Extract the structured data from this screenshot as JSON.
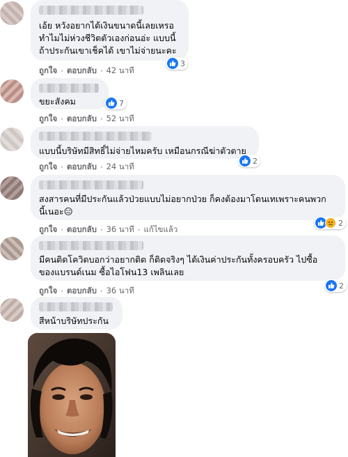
{
  "labels": {
    "like": "ถูกใจ",
    "reply": "ตอบกลับ",
    "edited": "แก้ไขแล้ว",
    "separator": "·"
  },
  "comments": [
    {
      "text": "เอ้ย หวังอยากได้เงินขนาดนี้เลยเหรอ\nทำไมไม่ห่วงชีวิตตัวเองก่อนอ่ะ แบบนี้\nถ้าประกันเขาเช็คได้ เขาไม่จ่ายนะคะ",
      "time": "42 นาที",
      "reaction_count": "3"
    },
    {
      "text": "ขยะสังคม",
      "time": "52 นาที",
      "reaction_count": "7"
    },
    {
      "text": "แบบนี้บริษัทมีสิทธิ์ไม่จ่ายไหมครับ เหมือนกรณีฆ่าตัวตาย",
      "time": "24 นาที",
      "reaction_count": "2"
    },
    {
      "text": "สงสารคนที่มีประกันแล้วป่วยแบบไม่อยากป่วย ก็คงต้องมาโดนเทเพราะคนพวก\nนี้เนอะ😑",
      "time": "36 นาที",
      "reaction_count": "2"
    },
    {
      "text": "มีคนติดโควิดบอกว่าอยากติด ก็ติดจริงๆ ได้เงินค่าประกันทั้งครอบครัว ไปซื้อ\nของแบรนด์เนม ซื้อไอโฟน13 เพลินเลย",
      "time": "36 นาที",
      "reaction_count": "2"
    },
    {
      "text": "สีหน้าบริษัทประกัน"
    }
  ],
  "colors": {
    "bubble": "#f0f2f5",
    "like_blue": "#1877f2",
    "meta_gray": "#65676b"
  }
}
